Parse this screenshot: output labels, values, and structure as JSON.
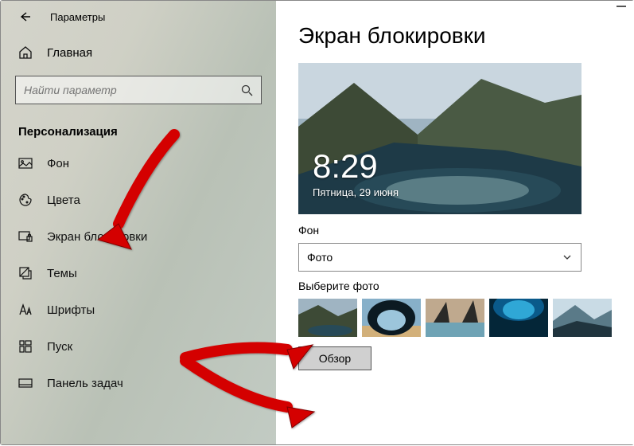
{
  "window": {
    "title": "Параметры"
  },
  "sidebar": {
    "home_label": "Главная",
    "search_placeholder": "Найти параметр",
    "group_label": "Персонализация",
    "items": [
      {
        "label": "Фон"
      },
      {
        "label": "Цвета"
      },
      {
        "label": "Экран блокировки"
      },
      {
        "label": "Темы"
      },
      {
        "label": "Шрифты"
      },
      {
        "label": "Пуск"
      },
      {
        "label": "Панель задач"
      }
    ]
  },
  "main": {
    "heading": "Экран блокировки",
    "preview": {
      "time": "8:29",
      "date": "Пятница, 29 июня"
    },
    "background_label": "Фон",
    "background_select": {
      "value": "Фото"
    },
    "choose_photo_label": "Выберите фото",
    "browse_label": "Обзор"
  }
}
